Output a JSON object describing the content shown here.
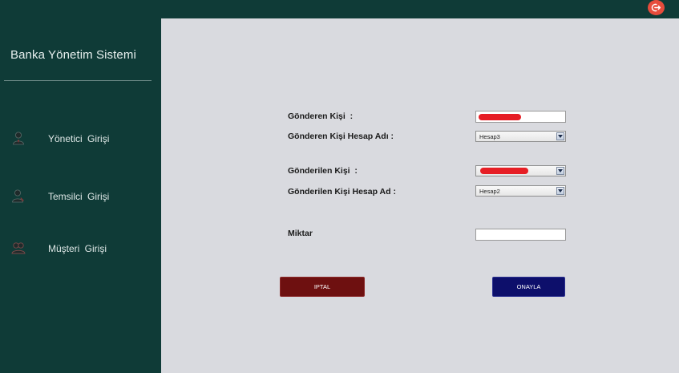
{
  "app": {
    "title": "Banka Yönetim Sistemi"
  },
  "topbar": {
    "exit_icon": "logout-icon",
    "accent_color": "#e74c3c"
  },
  "sidebar": {
    "items": [
      {
        "label": "Yönetici  Girişi",
        "icon": "admin-user-icon"
      },
      {
        "label": "Temsilci  Girişi",
        "icon": "representative-user-icon"
      },
      {
        "label": "Müşteri  Girişi",
        "icon": "customer-users-icon"
      }
    ]
  },
  "form": {
    "sender_label": "Gönderen Kişi  :",
    "sender_value": "",
    "sender_account_label": "Gönderen Kişi Hesap Adı :",
    "sender_account_selected": "Hesap3",
    "recipient_label": "Gönderilen Kişi  :",
    "recipient_selected": "",
    "recipient_account_label": "Gönderilen Kişi Hesap Ad :",
    "recipient_account_selected": "Hesap2",
    "amount_label": "Miktar",
    "amount_value": ""
  },
  "buttons": {
    "cancel_label": "IPTAL",
    "confirm_label": "ONAYLA",
    "cancel_color": "#6e1010",
    "confirm_color": "#0d0f6b"
  }
}
